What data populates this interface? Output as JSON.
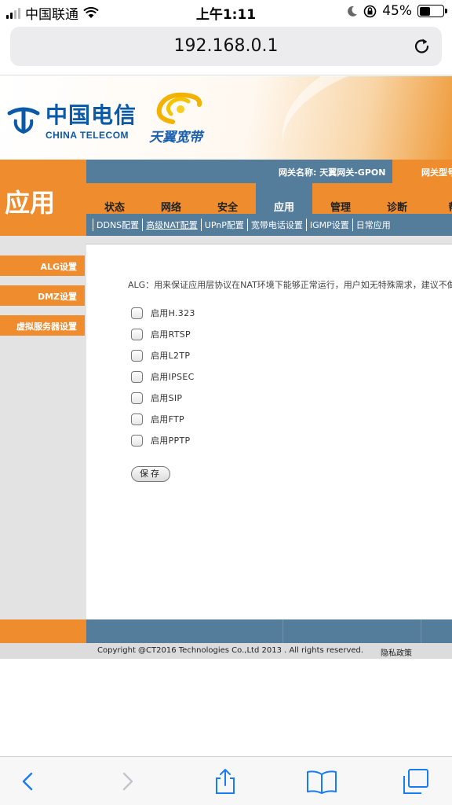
{
  "status_bar": {
    "carrier": "中国联通",
    "time": "上午1:11",
    "battery_percent": "45%",
    "battery_level": 0.45,
    "icons": [
      "signal-icon",
      "wifi-icon",
      "moon-icon",
      "orientation-lock-icon",
      "battery-icon"
    ]
  },
  "browser": {
    "url": "192.168.0.1",
    "reload_icon": "reload-icon",
    "toolbar_icons": [
      "back-icon",
      "forward-icon",
      "share-icon",
      "bookmarks-icon",
      "tabs-icon"
    ]
  },
  "header": {
    "logo_cn": "中国电信",
    "logo_en": "CHINA TELECOM",
    "brand2": "天翼宽带",
    "section_title": "应用",
    "gateway_name": "网关名称:  天翼网关-GPON",
    "gateway_model": "网关型号"
  },
  "tabs": [
    {
      "label": "状态"
    },
    {
      "label": "网络"
    },
    {
      "label": "安全"
    },
    {
      "label": "应用",
      "active": true
    },
    {
      "label": "管理"
    },
    {
      "label": "诊断"
    },
    {
      "label": "帮"
    }
  ],
  "subnav": [
    {
      "label": "DDNS配置"
    },
    {
      "label": "高级NAT配置",
      "active": true
    },
    {
      "label": "UPnP配置"
    },
    {
      "label": "宽带电话设置"
    },
    {
      "label": "IGMP设置"
    },
    {
      "label": "日常应用"
    }
  ],
  "sidebar": {
    "items": [
      {
        "label": "ALG设置"
      },
      {
        "label": "DMZ设置"
      },
      {
        "label": "虚拟服务器设置"
      }
    ]
  },
  "content": {
    "description": "ALG：用来保证应用层协议在NAT环境下能够正常运行，用户如无特殊需求，建议不做修",
    "options": [
      {
        "label": "启用H.323",
        "checked": false
      },
      {
        "label": "启用RTSP",
        "checked": false
      },
      {
        "label": "启用L2TP",
        "checked": false
      },
      {
        "label": "启用IPSEC",
        "checked": false
      },
      {
        "label": "启用SIP",
        "checked": false
      },
      {
        "label": "启用FTP",
        "checked": false
      },
      {
        "label": "启用PPTP",
        "checked": false
      }
    ],
    "save_label": "保存"
  },
  "footer": {
    "copyright": "Copyright @CT2016 Technologies Co.,Ltd 2013 . All rights reserved.",
    "privacy": "隐私政策"
  },
  "colors": {
    "orange": "#ef8c2e",
    "steel_blue": "#547d9c",
    "telecom_blue": "#0a5aa8",
    "ios_blue": "#1a7cf5"
  }
}
